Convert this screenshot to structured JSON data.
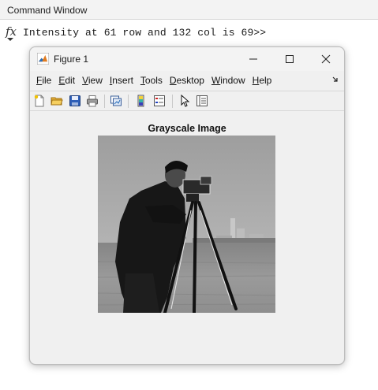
{
  "command_window": {
    "title": "Command Window",
    "prompt_icon": "fx-icon",
    "output_text": "Intensity at 61 row and 132 col is 69>>"
  },
  "figure": {
    "title": "Figure 1",
    "window_controls": {
      "minimize": "—",
      "maximize": "☐",
      "close": "✕"
    },
    "menu": [
      {
        "accel": "F",
        "rest": "ile"
      },
      {
        "accel": "E",
        "rest": "dit"
      },
      {
        "accel": "V",
        "rest": "iew"
      },
      {
        "accel": "I",
        "rest": "nsert"
      },
      {
        "accel": "T",
        "rest": "ools"
      },
      {
        "accel": "D",
        "rest": "esktop"
      },
      {
        "accel": "W",
        "rest": "indow"
      },
      {
        "accel": "H",
        "rest": "elp"
      }
    ],
    "menu_overflow_icon": "arrow-icon",
    "toolbar_icons": [
      "new-figure-icon",
      "open-icon",
      "save-icon",
      "print-icon",
      "link-plot-icon",
      "colorbar-icon",
      "legend-icon",
      "pointer-icon",
      "property-inspector-icon"
    ],
    "axes_title": "Grayscale Image",
    "image_name": "cameraman"
  }
}
